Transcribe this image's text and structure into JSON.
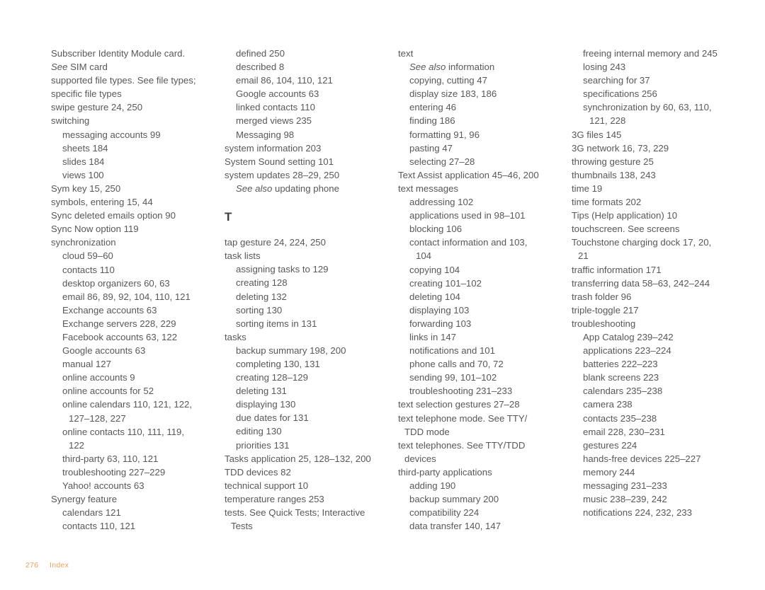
{
  "page": {
    "number": "276",
    "section_label": "Index",
    "footer_color": "#f5a05a",
    "text_color": "#58585b",
    "heading_color": "#3f3f41"
  },
  "columns": [
    {
      "id": "column-1",
      "blocks": [
        {
          "type": "entry",
          "level": 0,
          "text": "Subscriber Identity Module card."
        },
        {
          "type": "entry",
          "level": 0,
          "italic_prefix": "See",
          "text_rest": " SIM card",
          "continuation": true
        },
        {
          "type": "entry",
          "level": 0,
          "text": "supported file types. See file types;"
        },
        {
          "type": "entry",
          "level": 0,
          "text": "specific file types",
          "continuation": true
        },
        {
          "type": "entry",
          "level": 0,
          "text": "swipe gesture 24, 250"
        },
        {
          "type": "entry",
          "level": 0,
          "text": "switching"
        },
        {
          "type": "entry",
          "level": 1,
          "text": "messaging accounts 99"
        },
        {
          "type": "entry",
          "level": 1,
          "text": "sheets 184"
        },
        {
          "type": "entry",
          "level": 1,
          "text": "slides 184"
        },
        {
          "type": "entry",
          "level": 1,
          "text": "views 100"
        },
        {
          "type": "entry",
          "level": 0,
          "text": "Sym key 15, 250"
        },
        {
          "type": "entry",
          "level": 0,
          "text": "symbols, entering 15, 44"
        },
        {
          "type": "entry",
          "level": 0,
          "text": "Sync deleted emails option 90"
        },
        {
          "type": "entry",
          "level": 0,
          "text": "Sync Now option 119"
        },
        {
          "type": "entry",
          "level": 0,
          "text": "synchronization"
        },
        {
          "type": "entry",
          "level": 1,
          "text": "cloud 59–60"
        },
        {
          "type": "entry",
          "level": 1,
          "text": "contacts 110"
        },
        {
          "type": "entry",
          "level": 1,
          "text": "desktop organizers 60, 63"
        },
        {
          "type": "entry",
          "level": 1,
          "text": "email 86, 89, 92, 104, 110, 121"
        },
        {
          "type": "entry",
          "level": 1,
          "text": "Exchange accounts 63"
        },
        {
          "type": "entry",
          "level": 1,
          "text": "Exchange servers 228, 229"
        },
        {
          "type": "entry",
          "level": 1,
          "text": "Facebook accounts 63, 122"
        },
        {
          "type": "entry",
          "level": 1,
          "text": "Google accounts 63"
        },
        {
          "type": "entry",
          "level": 1,
          "text": "manual 127"
        },
        {
          "type": "entry",
          "level": 1,
          "text": "online accounts 9"
        },
        {
          "type": "entry",
          "level": 1,
          "text": "online accounts for 52"
        },
        {
          "type": "entry",
          "level": 1,
          "text": "online calendars 110, 121, 122, 127–128, 227"
        },
        {
          "type": "entry",
          "level": 1,
          "text": "online contacts 110, 111, 119, 122"
        },
        {
          "type": "entry",
          "level": 1,
          "text": "third-party 63, 110, 121"
        },
        {
          "type": "entry",
          "level": 1,
          "text": "troubleshooting 227–229"
        },
        {
          "type": "entry",
          "level": 1,
          "text": "Yahoo! accounts 63"
        },
        {
          "type": "entry",
          "level": 0,
          "text": "Synergy feature"
        },
        {
          "type": "entry",
          "level": 1,
          "text": "calendars 121"
        },
        {
          "type": "entry",
          "level": 1,
          "text": "contacts 110, 121"
        }
      ]
    },
    {
      "id": "column-2",
      "blocks": [
        {
          "type": "entry",
          "level": 1,
          "text": "defined 250"
        },
        {
          "type": "entry",
          "level": 1,
          "text": "described 8"
        },
        {
          "type": "entry",
          "level": 1,
          "text": "email 86, 104, 110, 121"
        },
        {
          "type": "entry",
          "level": 1,
          "text": "Google accounts 63"
        },
        {
          "type": "entry",
          "level": 1,
          "text": "linked contacts 110"
        },
        {
          "type": "entry",
          "level": 1,
          "text": "merged views 235"
        },
        {
          "type": "entry",
          "level": 1,
          "text": "Messaging 98"
        },
        {
          "type": "entry",
          "level": 0,
          "text": "system information 203"
        },
        {
          "type": "entry",
          "level": 0,
          "text": "System Sound setting 101"
        },
        {
          "type": "entry",
          "level": 0,
          "text": "system updates 28–29, 250"
        },
        {
          "type": "entry",
          "level": 1,
          "italic_prefix": "See also",
          "text_rest": " updating phone"
        },
        {
          "type": "letter-heading",
          "text": "T"
        },
        {
          "type": "entry",
          "level": 0,
          "text": "tap gesture 24, 224, 250"
        },
        {
          "type": "entry",
          "level": 0,
          "text": "task lists"
        },
        {
          "type": "entry",
          "level": 1,
          "text": "assigning tasks to 129"
        },
        {
          "type": "entry",
          "level": 1,
          "text": "creating 128"
        },
        {
          "type": "entry",
          "level": 1,
          "text": "deleting 132"
        },
        {
          "type": "entry",
          "level": 1,
          "text": "sorting 130"
        },
        {
          "type": "entry",
          "level": 1,
          "text": "sorting items in 131"
        },
        {
          "type": "entry",
          "level": 0,
          "text": "tasks"
        },
        {
          "type": "entry",
          "level": 1,
          "text": "backup summary 198, 200"
        },
        {
          "type": "entry",
          "level": 1,
          "text": "completing 130, 131"
        },
        {
          "type": "entry",
          "level": 1,
          "text": "creating 128–129"
        },
        {
          "type": "entry",
          "level": 1,
          "text": "deleting 131"
        },
        {
          "type": "entry",
          "level": 1,
          "text": "displaying 130"
        },
        {
          "type": "entry",
          "level": 1,
          "text": "due dates for 131"
        },
        {
          "type": "entry",
          "level": 1,
          "text": "editing 130"
        },
        {
          "type": "entry",
          "level": 1,
          "text": "priorities 131"
        },
        {
          "type": "entry",
          "level": 0,
          "text": "Tasks application 25, 128–132, 200"
        },
        {
          "type": "entry",
          "level": 0,
          "text": "TDD devices 82"
        },
        {
          "type": "entry",
          "level": 0,
          "text": "technical support 10"
        },
        {
          "type": "entry",
          "level": 0,
          "text": "temperature ranges 253"
        },
        {
          "type": "entry",
          "level": 0,
          "text": "tests. See Quick Tests; Interactive Tests"
        }
      ]
    },
    {
      "id": "column-3",
      "blocks": [
        {
          "type": "entry",
          "level": 0,
          "text": "text"
        },
        {
          "type": "entry",
          "level": 1,
          "italic_prefix": "See also",
          "text_rest": " information"
        },
        {
          "type": "entry",
          "level": 1,
          "text": "copying, cutting 47"
        },
        {
          "type": "entry",
          "level": 1,
          "text": "display size 183, 186"
        },
        {
          "type": "entry",
          "level": 1,
          "text": "entering 46"
        },
        {
          "type": "entry",
          "level": 1,
          "text": "finding 186"
        },
        {
          "type": "entry",
          "level": 1,
          "text": "formatting 91, 96"
        },
        {
          "type": "entry",
          "level": 1,
          "text": "pasting 47"
        },
        {
          "type": "entry",
          "level": 1,
          "text": "selecting 27–28"
        },
        {
          "type": "entry",
          "level": 0,
          "text": "Text Assist application 45–46, 200"
        },
        {
          "type": "entry",
          "level": 0,
          "text": "text messages"
        },
        {
          "type": "entry",
          "level": 1,
          "text": "addressing 102"
        },
        {
          "type": "entry",
          "level": 1,
          "text": "applications used in 98–101"
        },
        {
          "type": "entry",
          "level": 1,
          "text": "blocking 106"
        },
        {
          "type": "entry",
          "level": 1,
          "text": "contact information and 103, 104"
        },
        {
          "type": "entry",
          "level": 1,
          "text": "copying 104"
        },
        {
          "type": "entry",
          "level": 1,
          "text": "creating 101–102"
        },
        {
          "type": "entry",
          "level": 1,
          "text": "deleting 104"
        },
        {
          "type": "entry",
          "level": 1,
          "text": "displaying 103"
        },
        {
          "type": "entry",
          "level": 1,
          "text": "forwarding 103"
        },
        {
          "type": "entry",
          "level": 1,
          "text": "links in 147"
        },
        {
          "type": "entry",
          "level": 1,
          "text": "notifications and 101"
        },
        {
          "type": "entry",
          "level": 1,
          "text": "phone calls and 70, 72"
        },
        {
          "type": "entry",
          "level": 1,
          "text": "sending 99, 101–102"
        },
        {
          "type": "entry",
          "level": 1,
          "text": "troubleshooting 231–233"
        },
        {
          "type": "entry",
          "level": 0,
          "text": "text selection gestures 27–28"
        },
        {
          "type": "entry",
          "level": 0,
          "text": "text telephone mode. See TTY/ TDD mode"
        },
        {
          "type": "entry",
          "level": 0,
          "text": "text telephones. See TTY/TDD devices"
        },
        {
          "type": "entry",
          "level": 0,
          "text": "third-party applications"
        },
        {
          "type": "entry",
          "level": 1,
          "text": "adding 190"
        },
        {
          "type": "entry",
          "level": 1,
          "text": "backup summary 200"
        },
        {
          "type": "entry",
          "level": 1,
          "text": "compatibility 224"
        },
        {
          "type": "entry",
          "level": 1,
          "text": "data transfer 140, 147"
        }
      ]
    },
    {
      "id": "column-4",
      "blocks": [
        {
          "type": "entry",
          "level": 1,
          "text": "freeing internal memory and 245"
        },
        {
          "type": "entry",
          "level": 1,
          "text": "losing 243"
        },
        {
          "type": "entry",
          "level": 1,
          "text": "searching for 37"
        },
        {
          "type": "entry",
          "level": 1,
          "text": "specifications 256"
        },
        {
          "type": "entry",
          "level": 1,
          "text": "synchronization by 60, 63, 110, 121, 228"
        },
        {
          "type": "entry",
          "level": 0,
          "text": "3G files 145"
        },
        {
          "type": "entry",
          "level": 0,
          "text": "3G network 16, 73, 229"
        },
        {
          "type": "entry",
          "level": 0,
          "text": "throwing gesture 25"
        },
        {
          "type": "entry",
          "level": 0,
          "text": "thumbnails 138, 243"
        },
        {
          "type": "entry",
          "level": 0,
          "text": "time 19"
        },
        {
          "type": "entry",
          "level": 0,
          "text": "time formats 202"
        },
        {
          "type": "entry",
          "level": 0,
          "text": "Tips (Help application) 10"
        },
        {
          "type": "entry",
          "level": 0,
          "text": "touchscreen. See  screens"
        },
        {
          "type": "entry",
          "level": 0,
          "text": "Touchstone charging dock 17, 20, 21"
        },
        {
          "type": "entry",
          "level": 0,
          "text": "traffic information 171"
        },
        {
          "type": "entry",
          "level": 0,
          "text": "transferring data 58–63, 242–244"
        },
        {
          "type": "entry",
          "level": 0,
          "text": "trash folder 96"
        },
        {
          "type": "entry",
          "level": 0,
          "text": "triple-toggle 217"
        },
        {
          "type": "entry",
          "level": 0,
          "text": "troubleshooting"
        },
        {
          "type": "entry",
          "level": 1,
          "text": "App Catalog 239–242"
        },
        {
          "type": "entry",
          "level": 1,
          "text": "applications 223–224"
        },
        {
          "type": "entry",
          "level": 1,
          "text": "batteries 222–223"
        },
        {
          "type": "entry",
          "level": 1,
          "text": "blank screens 223"
        },
        {
          "type": "entry",
          "level": 1,
          "text": "calendars 235–238"
        },
        {
          "type": "entry",
          "level": 1,
          "text": "camera 238"
        },
        {
          "type": "entry",
          "level": 1,
          "text": "contacts 235–238"
        },
        {
          "type": "entry",
          "level": 1,
          "text": "email 228, 230–231"
        },
        {
          "type": "entry",
          "level": 1,
          "text": "gestures 224"
        },
        {
          "type": "entry",
          "level": 1,
          "text": "hands-free devices 225–227"
        },
        {
          "type": "entry",
          "level": 1,
          "text": "memory 244"
        },
        {
          "type": "entry",
          "level": 1,
          "text": "messaging 231–233"
        },
        {
          "type": "entry",
          "level": 1,
          "text": "music 238–239, 242"
        },
        {
          "type": "entry",
          "level": 1,
          "text": "notifications 224, 232, 233"
        }
      ]
    }
  ]
}
